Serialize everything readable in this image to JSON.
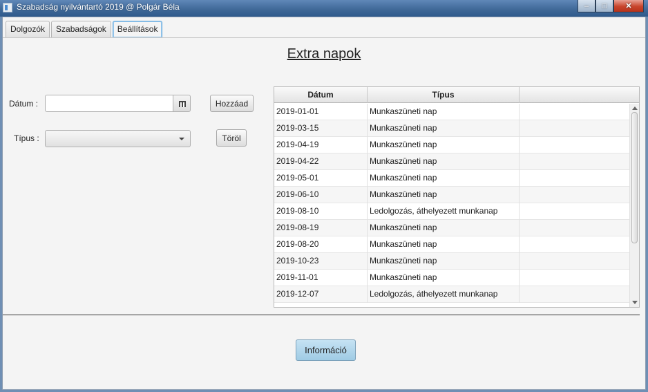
{
  "window": {
    "title": "Szabadság nyilvántartó 2019 @ Polgár Béla",
    "controls": [
      "minimize-icon",
      "maximize-icon",
      "close-icon"
    ]
  },
  "tabs": [
    {
      "label": "Dolgozók",
      "active": false
    },
    {
      "label": "Szabadságok",
      "active": false
    },
    {
      "label": "Beállítások",
      "active": true
    }
  ],
  "page": {
    "title": "Extra napok"
  },
  "form": {
    "date_label": "Dátum :",
    "date_value": "",
    "type_label": "Típus :",
    "type_value": "",
    "add_button": "Hozzáad",
    "delete_button": "Töröl"
  },
  "table": {
    "headers": [
      "Dátum",
      "Típus",
      ""
    ],
    "rows": [
      [
        "2019-01-01",
        "Munkaszüneti nap"
      ],
      [
        "2019-03-15",
        "Munkaszüneti nap"
      ],
      [
        "2019-04-19",
        "Munkaszüneti nap"
      ],
      [
        "2019-04-22",
        "Munkaszüneti nap"
      ],
      [
        "2019-05-01",
        "Munkaszüneti nap"
      ],
      [
        "2019-06-10",
        "Munkaszüneti nap"
      ],
      [
        "2019-08-10",
        "Ledolgozás, áthelyezett munkanap"
      ],
      [
        "2019-08-19",
        "Munkaszüneti nap"
      ],
      [
        "2019-08-20",
        "Munkaszüneti nap"
      ],
      [
        "2019-10-23",
        "Munkaszüneti nap"
      ],
      [
        "2019-11-01",
        "Munkaszüneti nap"
      ],
      [
        "2019-12-07",
        "Ledolgozás, áthelyezett munkanap"
      ]
    ]
  },
  "footer": {
    "info_button": "Információ"
  },
  "colors": {
    "title_bar": "#3e6796",
    "active_tab_border": "#5fa3d8",
    "info_button": "#9fcbe4",
    "window_bg": "#f4f4f4"
  }
}
